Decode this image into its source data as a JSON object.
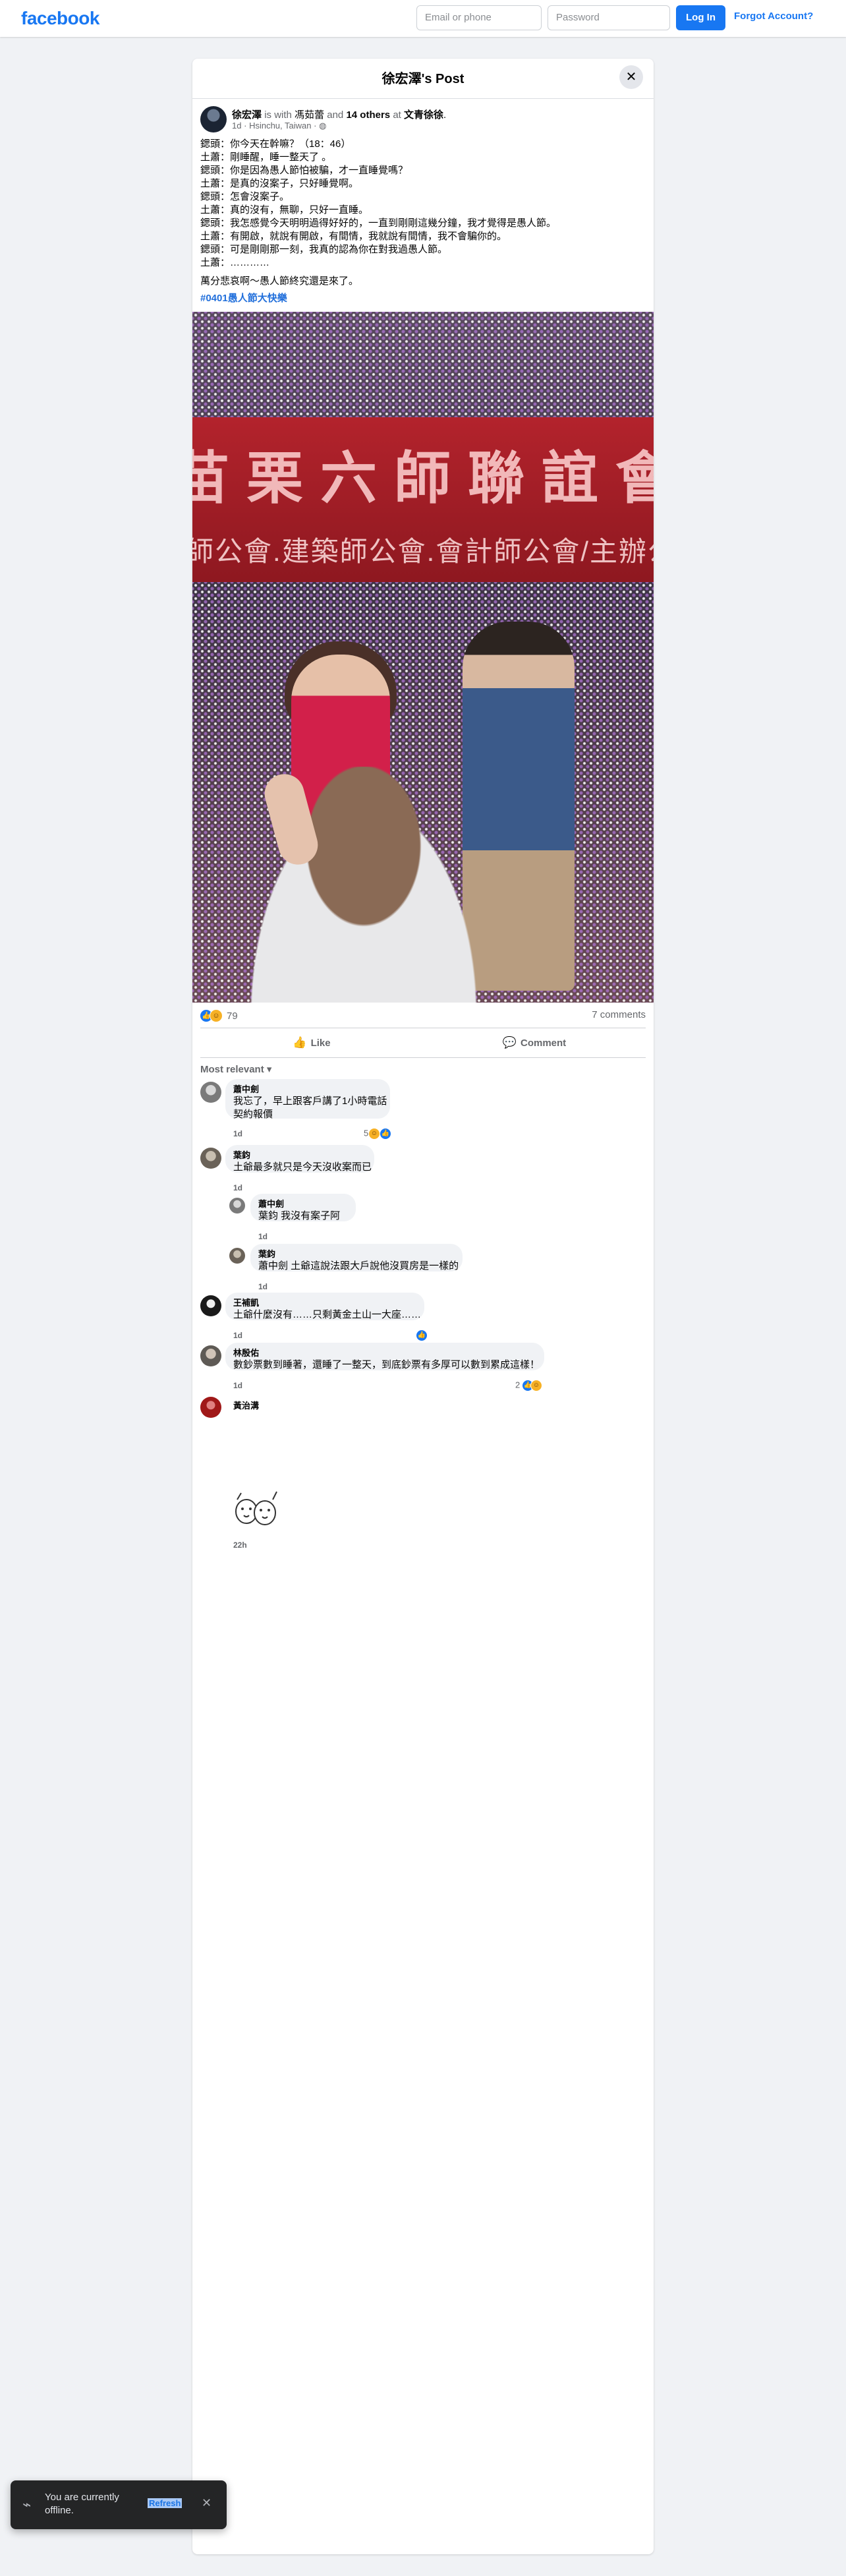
{
  "topbar": {
    "logo": "facebook",
    "email_placeholder": "Email or phone",
    "password_placeholder": "Password",
    "login_label": "Log In",
    "forgot_label": "Forgot Account?"
  },
  "post": {
    "title": "徐宏澤's Post",
    "close_icon": "close-icon",
    "author": "徐宏澤",
    "is_with": "is with",
    "tagged_1": "馮茹蕾",
    "and": "and",
    "others": "14 others",
    "at": "at",
    "place": "文青徐徐",
    "period": ".",
    "time": "1d",
    "dot": "·",
    "location": "Hsinchu, Taiwan",
    "privacy_icon": "globe-icon",
    "lines": [
      "鍶頭：你今天在幹嘛？（18：46）",
      "土蕭：剛睡醒，睡一整天了 。",
      "鍶頭：你是因為愚人節怕被騙，才一直睡覺嗎？",
      "土蕭：是真的沒案子，只好睡覺啊。",
      "鍶頭：怎會沒案子。",
      "土蕭：真的沒有，無聊，只好一直睡。",
      "鍶頭：我怎感覺今天明明過得好好的，一直到剛剛這幾分鐘，我才覺得是愚人節。",
      "土蕭：有開啟，就說有開啟，有間情，我就說有間情，我不會騙你的。",
      "鍶頭：可是剛剛那一刻，我真的認為你在對我過愚人節。",
      "土蕭：…………",
      "",
      "萬分悲哀啊～愚人節終究還是來了。"
    ],
    "hashtag": "#0401愚人節大快樂",
    "photo_banner_big": "苗栗六師聯誼會",
    "photo_banner_small": "師公會.建築師公會.會計師公會/主辦公會:苗",
    "reaction_count": "79",
    "comment_count": "7 comments",
    "like_label": "Like",
    "comment_label": "Comment",
    "sort_label": "Most relevant"
  },
  "comments": [
    {
      "name": "蕭中劍",
      "lines": [
        "我忘了，早上跟客戶講了1小時電話",
        "契約報價"
      ],
      "time": "1d",
      "react": "5"
    },
    {
      "name": "葉鈞",
      "lines": [
        "土爺最多就只是今天沒收案而已"
      ],
      "time": "1d",
      "react": ""
    },
    {
      "name": "蕭中劍",
      "lines": [
        "葉鈞 我沒有案子阿"
      ],
      "time": "1d",
      "react": ""
    },
    {
      "name": "葉鈞",
      "lines": [
        "蕭中劍 土爺這說法跟大戶說他沒買房是一樣的"
      ],
      "time": "1d",
      "react": ""
    },
    {
      "name": "王補凱",
      "lines": [
        "土爺什麼沒有……只剩黃金土山一大座……"
      ],
      "time": "1d",
      "react": ""
    },
    {
      "name": "林殷佑",
      "lines": [
        "數鈔票數到睡著，還睡了一整天，到底鈔票有多厚可以數到累成這樣！"
      ],
      "time": "1d",
      "react": "2"
    },
    {
      "name": "黃治溝",
      "lines": [],
      "time": "22h",
      "react": "",
      "sticker": "sticker-icon"
    }
  ],
  "toast": {
    "text": "You are currently offline.",
    "refresh": "Refresh",
    "icon": "offline-wifi-icon"
  },
  "colors": {
    "brand": "#1877f2",
    "background": "#f0f2f5",
    "link": "#216fdb"
  }
}
